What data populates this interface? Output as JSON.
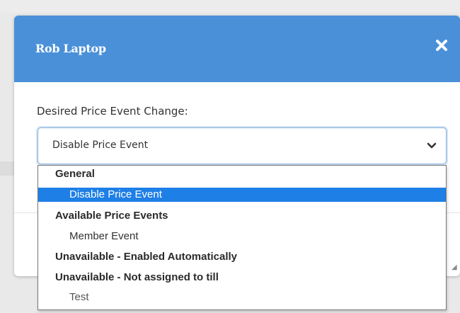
{
  "modal": {
    "title": "Rob Laptop",
    "close_icon": "close-icon"
  },
  "form": {
    "label": "Desired Price Event Change:",
    "select_value": "Disable Price Event",
    "chevron_icon": "chevron-down-icon"
  },
  "dropdown": {
    "options": [
      {
        "label": "General",
        "kind": "group"
      },
      {
        "label": "Disable Price Event",
        "kind": "item",
        "selected": true
      },
      {
        "label": "Available Price Events",
        "kind": "group"
      },
      {
        "label": "Member Event",
        "kind": "item"
      },
      {
        "label": "Unavailable - Enabled Automatically",
        "kind": "group"
      },
      {
        "label": "Unavailable - Not assigned to till",
        "kind": "group"
      },
      {
        "label": "Test",
        "kind": "item"
      }
    ]
  },
  "colors": {
    "header": "#4a90d9",
    "selected_option": "#1e7fe6"
  }
}
